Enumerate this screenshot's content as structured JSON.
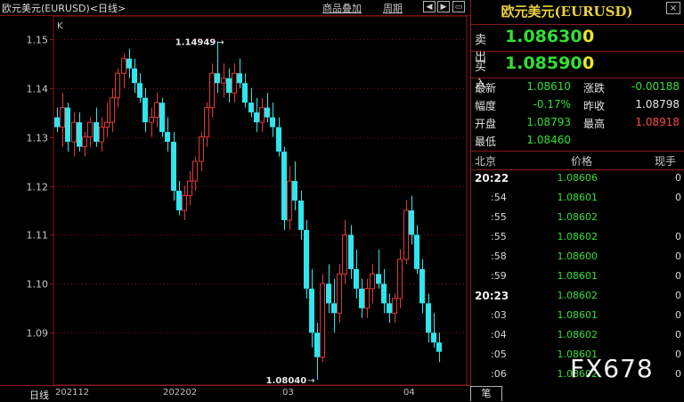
{
  "window": {
    "title": "欧元美元(EURUSD)<日线>",
    "buttons": {
      "overlay": "商品叠加",
      "period": "周期"
    },
    "nav_icons": [
      "scroll-left-icon",
      "scroll-right-icon",
      "zoom-icon"
    ]
  },
  "chart_data": {
    "type": "candlestick",
    "title": "",
    "period_label": "日线",
    "y_ticks": [
      1.15,
      1.14,
      1.13,
      1.12,
      1.11,
      1.1,
      1.09
    ],
    "ylim": [
      1.0793,
      1.1547
    ],
    "x_tick_labels": [
      "202112",
      "202202",
      "03",
      "04"
    ],
    "annotations": [
      {
        "text": "1.14949",
        "type": "high"
      },
      {
        "text": "1.08040",
        "type": "low"
      }
    ],
    "scale_marker": "K",
    "up_color": "#e23838",
    "down_color": "#2ee6ee",
    "candles": [
      [
        1.134,
        1.136,
        1.131,
        1.132
      ],
      [
        1.132,
        1.139,
        1.128,
        1.136
      ],
      [
        1.136,
        1.137,
        1.127,
        1.129
      ],
      [
        1.129,
        1.135,
        1.126,
        1.133
      ],
      [
        1.133,
        1.135,
        1.127,
        1.128
      ],
      [
        1.128,
        1.131,
        1.126,
        1.13
      ],
      [
        1.13,
        1.134,
        1.128,
        1.133
      ],
      [
        1.133,
        1.136,
        1.128,
        1.129
      ],
      [
        1.129,
        1.134,
        1.127,
        1.132
      ],
      [
        1.132,
        1.137,
        1.13,
        1.133
      ],
      [
        1.133,
        1.14,
        1.131,
        1.138
      ],
      [
        1.138,
        1.144,
        1.136,
        1.143
      ],
      [
        1.143,
        1.147,
        1.14,
        1.146
      ],
      [
        1.146,
        1.148,
        1.142,
        1.144
      ],
      [
        1.144,
        1.146,
        1.139,
        1.141
      ],
      [
        1.141,
        1.143,
        1.137,
        1.138
      ],
      [
        1.138,
        1.14,
        1.131,
        1.133
      ],
      [
        1.133,
        1.136,
        1.13,
        1.134
      ],
      [
        1.134,
        1.139,
        1.132,
        1.137
      ],
      [
        1.137,
        1.138,
        1.13,
        1.131
      ],
      [
        1.131,
        1.134,
        1.127,
        1.129
      ],
      [
        1.129,
        1.131,
        1.117,
        1.119
      ],
      [
        1.119,
        1.121,
        1.114,
        1.115
      ],
      [
        1.115,
        1.12,
        1.113,
        1.118
      ],
      [
        1.118,
        1.123,
        1.116,
        1.121
      ],
      [
        1.121,
        1.126,
        1.119,
        1.125
      ],
      [
        1.125,
        1.131,
        1.123,
        1.13
      ],
      [
        1.13,
        1.137,
        1.128,
        1.136
      ],
      [
        1.136,
        1.145,
        1.134,
        1.143
      ],
      [
        1.143,
        1.1495,
        1.139,
        1.141
      ],
      [
        1.141,
        1.145,
        1.138,
        1.142
      ],
      [
        1.142,
        1.144,
        1.137,
        1.139
      ],
      [
        1.139,
        1.145,
        1.137,
        1.143
      ],
      [
        1.143,
        1.146,
        1.14,
        1.141
      ],
      [
        1.141,
        1.143,
        1.136,
        1.137
      ],
      [
        1.137,
        1.14,
        1.134,
        1.135
      ],
      [
        1.135,
        1.138,
        1.131,
        1.133
      ],
      [
        1.133,
        1.138,
        1.131,
        1.136
      ],
      [
        1.136,
        1.139,
        1.133,
        1.134
      ],
      [
        1.134,
        1.137,
        1.13,
        1.132
      ],
      [
        1.132,
        1.134,
        1.126,
        1.127
      ],
      [
        1.127,
        1.128,
        1.111,
        1.113
      ],
      [
        1.113,
        1.124,
        1.111,
        1.121
      ],
      [
        1.121,
        1.125,
        1.115,
        1.117
      ],
      [
        1.117,
        1.119,
        1.109,
        1.111
      ],
      [
        1.111,
        1.113,
        1.097,
        1.099
      ],
      [
        1.099,
        1.103,
        1.087,
        1.09
      ],
      [
        1.09,
        1.092,
        1.0804,
        1.085
      ],
      [
        1.085,
        1.102,
        1.084,
        1.1
      ],
      [
        1.1,
        1.104,
        1.094,
        1.096
      ],
      [
        1.096,
        1.101,
        1.09,
        1.094
      ],
      [
        1.094,
        1.104,
        1.092,
        1.102
      ],
      [
        1.102,
        1.113,
        1.1,
        1.11
      ],
      [
        1.11,
        1.112,
        1.101,
        1.103
      ],
      [
        1.103,
        1.107,
        1.097,
        1.099
      ],
      [
        1.099,
        1.101,
        1.093,
        1.095
      ],
      [
        1.095,
        1.101,
        1.093,
        1.099
      ],
      [
        1.099,
        1.104,
        1.096,
        1.102
      ],
      [
        1.102,
        1.107,
        1.099,
        1.1
      ],
      [
        1.1,
        1.103,
        1.094,
        1.096
      ],
      [
        1.096,
        1.098,
        1.092,
        1.094
      ],
      [
        1.094,
        1.098,
        1.092,
        1.097
      ],
      [
        1.097,
        1.107,
        1.095,
        1.105
      ],
      [
        1.105,
        1.117,
        1.104,
        1.115
      ],
      [
        1.115,
        1.118,
        1.108,
        1.11
      ],
      [
        1.11,
        1.112,
        1.102,
        1.103
      ],
      [
        1.103,
        1.105,
        1.094,
        1.096
      ],
      [
        1.096,
        1.098,
        1.088,
        1.09
      ],
      [
        1.09,
        1.094,
        1.087,
        1.088
      ],
      [
        1.088,
        1.09,
        1.084,
        1.0861
      ]
    ]
  },
  "quote": {
    "name": "欧元美元(EURUSD)",
    "close_icon": "close-icon",
    "sell": {
      "label": "卖出",
      "price": "1.08630",
      "volume": "0"
    },
    "buy": {
      "label": "买入",
      "price": "1.08590",
      "volume": "0"
    },
    "stats": {
      "latest_label": "最新",
      "latest": "1.08610",
      "change_label": "涨跌",
      "change": "-0.00188",
      "pct_label": "幅度",
      "pct": "-0.17%",
      "prev_label": "昨收",
      "prev": "1.08798",
      "open_label": "开盘",
      "open": "1.08793",
      "high_label": "最高",
      "high": "1.08918",
      "low_label": "最低",
      "low": "1.08460"
    },
    "ticks_header": {
      "time": "北京",
      "price": "价格",
      "volume": "现手"
    },
    "ticks": [
      {
        "time": "20:22",
        "price": "1.08606",
        "volume": "0"
      },
      {
        "time": ":54",
        "price": "1.08601",
        "volume": "0"
      },
      {
        "time": ":55",
        "price": "1.08602",
        "volume": ""
      },
      {
        "time": ":55",
        "price": "1.08602",
        "volume": "0"
      },
      {
        "time": ":58",
        "price": "1.08600",
        "volume": "0"
      },
      {
        "time": ":59",
        "price": "1.08601",
        "volume": "0"
      },
      {
        "time": "20:23",
        "price": "1.08602",
        "volume": "0"
      },
      {
        "time": ":03",
        "price": "1.08601",
        "volume": "0"
      },
      {
        "time": ":04",
        "price": "1.08602",
        "volume": "0"
      },
      {
        "time": ":05",
        "price": "1.08601",
        "volume": "0"
      },
      {
        "time": ":06",
        "price": "1.08602",
        "volume": "0"
      }
    ],
    "tab_label": "笔"
  },
  "watermark": "FX678"
}
